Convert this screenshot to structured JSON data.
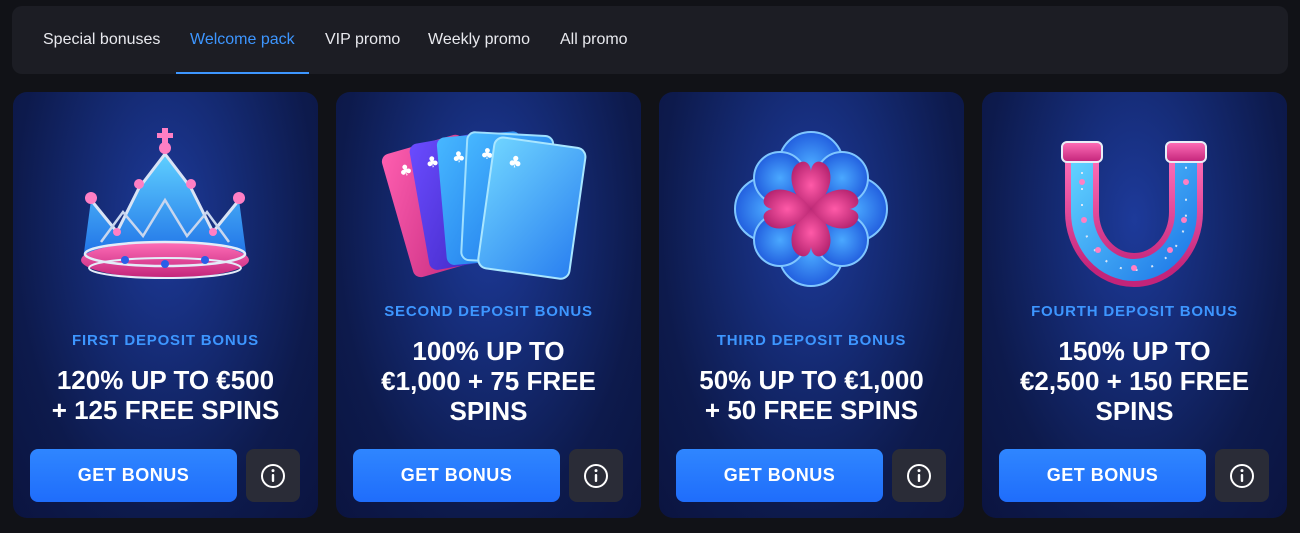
{
  "tabs": [
    {
      "label": "Special bonuses"
    },
    {
      "label": "Welcome pack"
    },
    {
      "label": "VIP promo"
    },
    {
      "label": "Weekly promo"
    },
    {
      "label": "All promo"
    }
  ],
  "active_tab": "Welcome pack",
  "cards": [
    {
      "label": "FIRST DEPOSIT BONUS",
      "title_line1": "120% UP TO €500",
      "title_line2": "+ 125 FREE SPINS",
      "title_line3": "",
      "button": "GET BONUS",
      "icon": "crown-icon"
    },
    {
      "label": "SECOND DEPOSIT BONUS",
      "title_line1": "100% UP TO",
      "title_line2": "€1,000 + 75 FREE",
      "title_line3": "SPINS",
      "button": "GET BONUS",
      "icon": "playing-cards-icon"
    },
    {
      "label": "THIRD DEPOSIT BONUS",
      "title_line1": "50% UP TO €1,000",
      "title_line2": "+ 50 FREE SPINS",
      "title_line3": "",
      "button": "GET BONUS",
      "icon": "four-leaf-clover-icon"
    },
    {
      "label": "FOURTH DEPOSIT BONUS",
      "title_line1": "150% UP TO",
      "title_line2": "€2,500 + 150 FREE",
      "title_line3": "SPINS",
      "button": "GET BONUS",
      "icon": "horseshoe-icon"
    }
  ],
  "colors": {
    "accent": "#3d96ff",
    "button": "#2379fd",
    "card_bg": "#142970",
    "page_bg": "#111217"
  }
}
